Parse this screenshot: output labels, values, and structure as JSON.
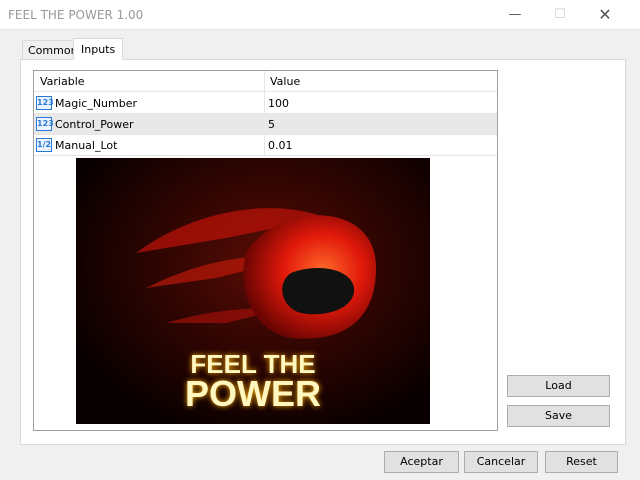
{
  "window": {
    "title": "FEEL THE POWER 1.00",
    "minimize_icon": "minimize-icon",
    "maximize_icon": "maximize-icon",
    "close_icon": "close-icon"
  },
  "tabs": [
    {
      "label": "Common"
    },
    {
      "label": "Inputs"
    }
  ],
  "table": {
    "headers": [
      "Variable",
      "Value"
    ],
    "rows": [
      {
        "icon": "123",
        "variable": "Magic_Number",
        "value": "100"
      },
      {
        "icon": "123",
        "variable": "Control_Power",
        "value": "5"
      },
      {
        "icon": "1/2",
        "variable": "Manual_Lot",
        "value": "0.01"
      }
    ]
  },
  "banner": {
    "line1": "FEEL THE",
    "line2": "POWER"
  },
  "buttons": {
    "load": "Load",
    "save": "Save",
    "accept": "Aceptar",
    "cancel": "Cancelar",
    "reset": "Reset"
  }
}
